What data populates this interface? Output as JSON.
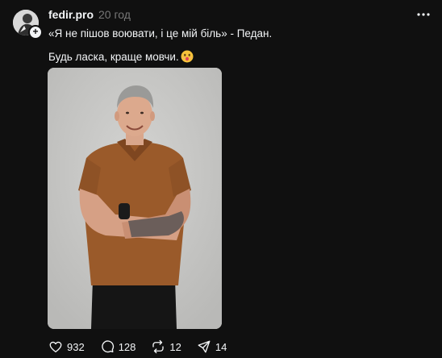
{
  "post": {
    "author": {
      "username": "fedir.pro",
      "avatar_icon": "avatar",
      "follow_badge": "+"
    },
    "timestamp": "20 год",
    "text": {
      "line1": "«Я не пішов воювати, і це мій біль» - Педан.",
      "line2": "Будь ласка, краще мовчи."
    },
    "emoji_icon": "shocked-face-emoji",
    "image_icon": "photo-man-brown-shirt"
  },
  "actions": {
    "like": {
      "icon": "heart-icon",
      "count": "932"
    },
    "comment": {
      "icon": "comment-icon",
      "count": "128"
    },
    "repost": {
      "icon": "repost-icon",
      "count": "12"
    },
    "share": {
      "icon": "send-icon",
      "count": "14"
    }
  },
  "colors": {
    "background": "#101010",
    "text": "#f3f5f7",
    "muted": "#777777"
  }
}
